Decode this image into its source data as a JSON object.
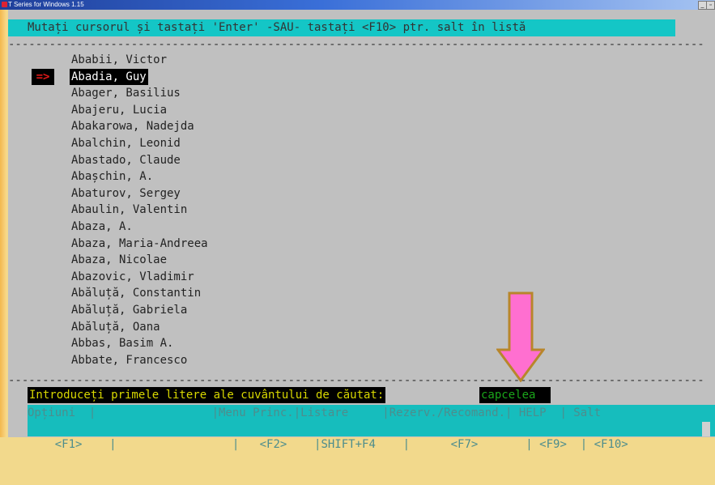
{
  "window": {
    "title": "T Series for Windows 1.15",
    "min_label": "_",
    "max_label": "▫"
  },
  "prompt": "Mutați cursorul și tastați 'Enter' -SAU- tastați <F10> ptr. salt în listă",
  "separator": "------------------------------------------------------------------------------------------------------",
  "list": {
    "selected_marker": "=>",
    "items": [
      "Ababii, Victor",
      "Abadia, Guy",
      "Abager, Basilius",
      "Abajeru, Lucia",
      "Abakarowa, Nadejda",
      "Abalchin, Leonid",
      "Abastado, Claude",
      "Abașchin, A.",
      "Abaturov, Sergey",
      "Abaulin, Valentin",
      "Abaza, A.",
      "Abaza, Maria-Andreea",
      "Abaza, Nicolae",
      "Abazovic, Vladimir",
      "Abăluță, Constantin",
      "Abăluță, Gabriela",
      "Abăluță, Oana",
      "Abbas, Basim A.",
      "Abbate, Francesco"
    ]
  },
  "search": {
    "label": "Introduceți primele litere ale cuvântului de căutat:",
    "value": "capcelea"
  },
  "footer": {
    "line1": "Opțiuni  |                 |Menu Princ.|Listare     |Rezerv./Recomand.| HELP  | Salt",
    "line2": "<F1>    |                 |   <F2>    |SHIFT+F4    |      <F7>       | <F9>  | <F10>"
  },
  "colors": {
    "annotation_arrow_fill": "#ff6fd0",
    "annotation_arrow_stroke": "#b8862b"
  }
}
